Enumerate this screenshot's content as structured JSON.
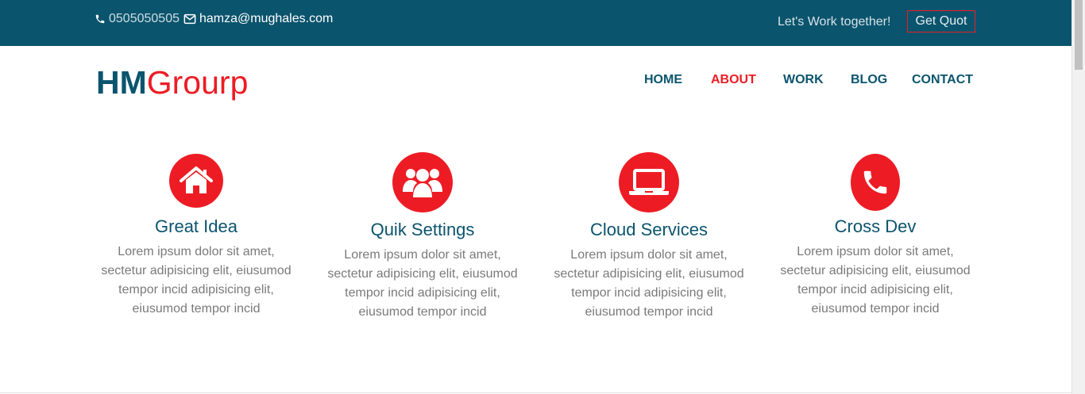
{
  "topbar": {
    "phone": "0505050505",
    "email": "hamza@mughales.com",
    "tagline": "Let's Work together!",
    "quote_button": "Get Quot",
    "icons": {
      "phone": "phone-icon",
      "email": "envelope-icon"
    }
  },
  "logo": {
    "part1": "HM",
    "part2": "Grourp"
  },
  "nav": [
    {
      "label": "HOME",
      "active": false
    },
    {
      "label": "ABOUT",
      "active": true
    },
    {
      "label": "WORK",
      "active": false
    },
    {
      "label": "BLOG",
      "active": false
    },
    {
      "label": "CONTACT",
      "active": false
    }
  ],
  "features": [
    {
      "icon": "home-icon",
      "title": "Great Idea",
      "text": "Lorem ipsum dolor sit amet, sectetur adipisicing elit, eiusumod tempor incid adipisicing elit, eiusumod tempor incid"
    },
    {
      "icon": "users-icon",
      "title": "Quik Settings",
      "text": "Lorem ipsum dolor sit amet, sectetur adipisicing elit, eiusumod tempor incid adipisicing elit, eiusumod tempor incid"
    },
    {
      "icon": "laptop-icon",
      "title": "Cloud Services",
      "text": "Lorem ipsum dolor sit amet, sectetur adipisicing elit, eiusumod tempor incid adipisicing elit, eiusumod tempor incid"
    },
    {
      "icon": "phone-icon",
      "title": "Cross Dev",
      "text": "Lorem ipsum dolor sit amet, sectetur adipisicing elit, eiusumod tempor incid adipisicing elit, eiusumod tempor incid"
    }
  ],
  "colors": {
    "primary": "#0b546d",
    "accent": "#ed1c24",
    "body_text": "#7a7a7a"
  }
}
